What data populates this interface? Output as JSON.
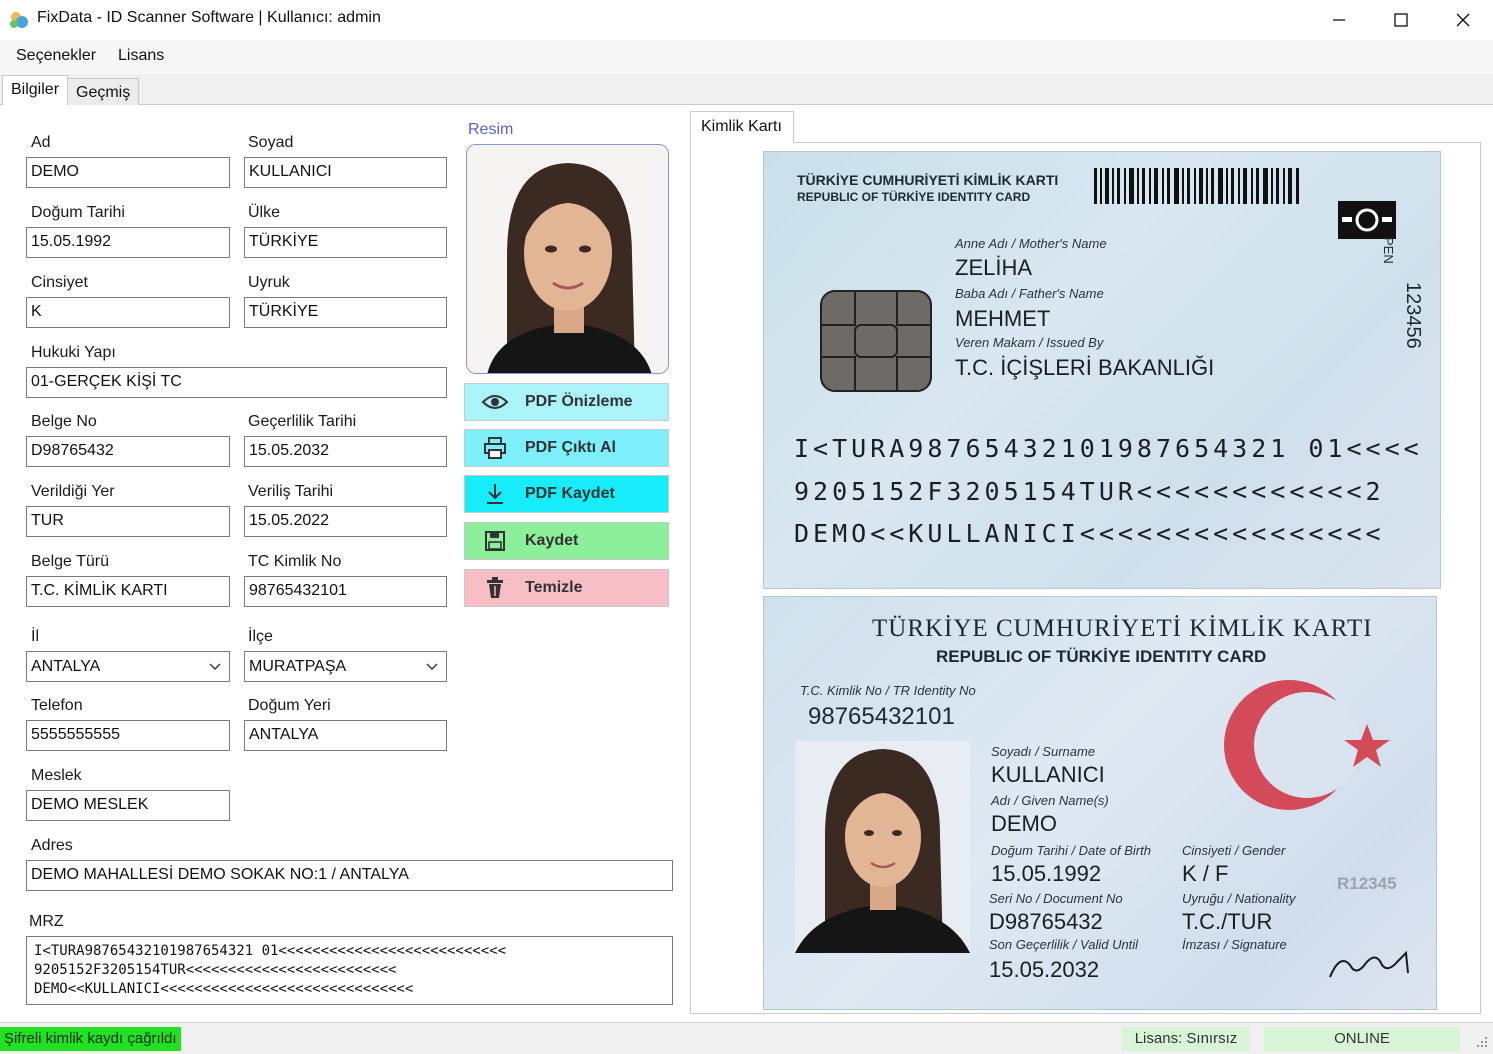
{
  "window": {
    "title": "FixData - ID Scanner Software  |  Kullanıcı: admin",
    "icons": {
      "app": "app-logo-icon",
      "minimize": "minimize-icon",
      "maximize": "maximize-icon",
      "close": "close-icon"
    }
  },
  "menu": {
    "items": [
      "Seçenekler",
      "Lisans"
    ]
  },
  "tabs": [
    "Bilgiler",
    "Geçmiş"
  ],
  "form": {
    "ad": {
      "label": "Ad",
      "value": "DEMO"
    },
    "soyad": {
      "label": "Soyad",
      "value": "KULLANICI"
    },
    "dogum_tarihi": {
      "label": "Doğum Tarihi",
      "value": "15.05.1992"
    },
    "ulke": {
      "label": "Ülke",
      "value": "TÜRKİYE"
    },
    "cinsiyet": {
      "label": "Cinsiyet",
      "value": "K"
    },
    "uyruk": {
      "label": "Uyruk",
      "value": "TÜRKİYE"
    },
    "hukuki_yapi": {
      "label": "Hukuki Yapı",
      "value": "01-GERÇEK KİŞİ TC"
    },
    "belge_no": {
      "label": "Belge No",
      "value": "D98765432"
    },
    "gecerlilik": {
      "label": "Geçerlilik Tarihi",
      "value": "15.05.2032"
    },
    "verildigi_yer": {
      "label": "Verildiği Yer",
      "value": "TUR"
    },
    "verilis_tarihi": {
      "label": "Veriliş Tarihi",
      "value": "15.05.2022"
    },
    "belge_turu": {
      "label": "Belge Türü",
      "value": "T.C. KİMLİK KARTI"
    },
    "tc_kimlik_no": {
      "label": "TC Kimlik No",
      "value": "98765432101"
    },
    "il": {
      "label": "İl",
      "value": "ANTALYA"
    },
    "ilce": {
      "label": "İlçe",
      "value": "MURATPAŞA"
    },
    "telefon": {
      "label": "Telefon",
      "value": "5555555555"
    },
    "dogum_yeri": {
      "label": "Doğum Yeri",
      "value": "ANTALYA"
    },
    "meslek": {
      "label": "Meslek",
      "value": "DEMO MESLEK"
    },
    "adres": {
      "label": "Adres",
      "value": "DEMO MAHALLESİ DEMO SOKAK NO:1 / ANTALYA"
    },
    "mrz": {
      "label": "MRZ",
      "lines": [
        "I<TURA98765432101987654321 01<<<<<<<<<<<<<<<<<<<<<<<<<<<",
        "9205152F3205154TUR<<<<<<<<<<<<<<<<<<<<<<<<<",
        "DEMO<<KULLANICI<<<<<<<<<<<<<<<<<<<<<<<<<<<<<<"
      ]
    }
  },
  "photo": {
    "label": "Resim"
  },
  "actions": {
    "preview": {
      "label": "PDF Önizleme",
      "color": "#a9f3f9",
      "icon": "eye-icon"
    },
    "print": {
      "label": "PDF Çıktı Al",
      "color": "#7df0fb",
      "icon": "printer-icon"
    },
    "save_pdf": {
      "label": "PDF Kaydet",
      "color": "#16ecfa",
      "icon": "download-icon"
    },
    "save": {
      "label": "Kaydet",
      "color": "#8cf09a",
      "icon": "floppy-disk-icon"
    },
    "clear": {
      "label": "Temizle",
      "color": "#f8bec6",
      "icon": "trash-icon"
    }
  },
  "card_panel": {
    "tab": "Kimlik Kartı",
    "back": {
      "title_tr": "TÜRKİYE CUMHURİYETİ KİMLİK KARTI",
      "title_en": "REPUBLIC OF TÜRKİYE IDENTITY CARD",
      "mother_caption": "Anne Adı / Mother's Name",
      "mother_value": "ZELİHA",
      "father_caption": "Baba Adı / Father's Name",
      "father_value": "MEHMET",
      "issued_caption": "Veren Makam / Issued By",
      "issued_value": "T.C. İÇİŞLERİ BAKANLIĞI",
      "side_label": "PEN",
      "side_number": "123456",
      "mrz": [
        "I<TURA98765432101987654321 01<<<<",
        "9205152F3205154TUR<<<<<<<<<<<<2",
        "DEMO<<KULLANICI<<<<<<<<<<<<<<<<"
      ]
    },
    "front": {
      "title_tr": "TÜRKİYE CUMHURİYETİ KİMLİK KARTI",
      "title_en": "REPUBLIC OF TÜRKİYE IDENTITY CARD",
      "tc_caption": "T.C. Kimlik No / TR Identity No",
      "tc_value": "98765432101",
      "surname_caption": "Soyadı / Surname",
      "surname_value": "KULLANICI",
      "name_caption": "Adı / Given Name(s)",
      "name_value": "DEMO",
      "dob_caption": "Doğum Tarihi / Date of Birth",
      "dob_value": "15.05.1992",
      "gender_caption": "Cinsiyeti / Gender",
      "gender_value": "K / F",
      "serial_caption": "Seri No / Document No",
      "serial_value": "D98765432",
      "nationality_caption": "Uyruğu / Nationality",
      "nationality_value": "T.C./TUR",
      "valid_caption": "Son Geçerlilik / Valid Until",
      "valid_value": "15.05.2032",
      "signature_caption": "İmzası / Signature",
      "ghost_code": "R12345"
    }
  },
  "status": {
    "message": "Şifreli kimlik kaydı çağrıldı",
    "message_color": "#22e022",
    "license": "Lisans: Sınırsız",
    "connection": "ONLINE"
  }
}
